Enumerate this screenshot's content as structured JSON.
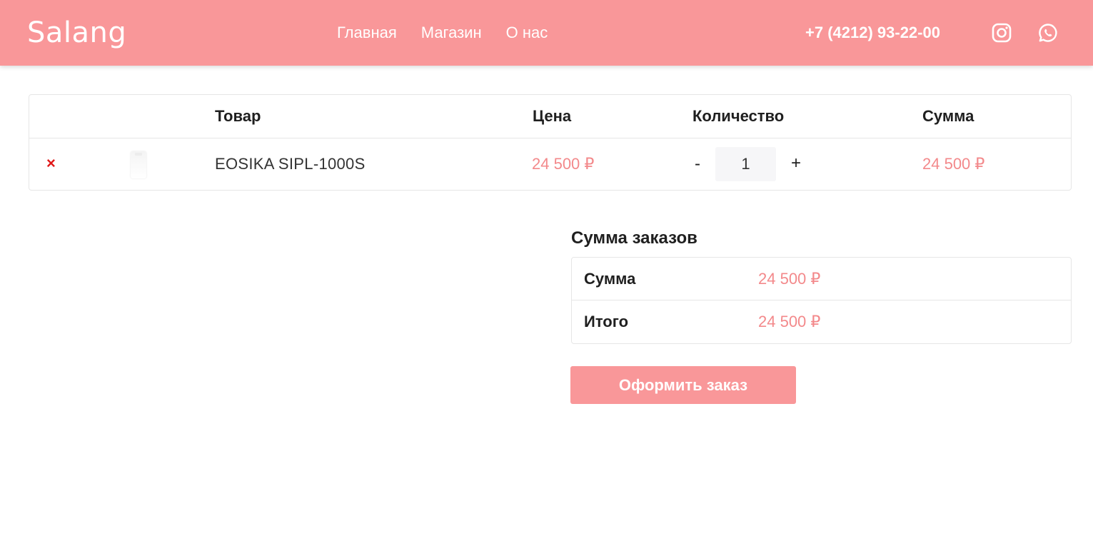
{
  "header": {
    "logo": "Salang",
    "nav": [
      "Главная",
      "Магазин",
      "О нас"
    ],
    "phone": "+7 (4212) 93-22-00",
    "social_icons": [
      "instagram-icon",
      "whatsapp-icon"
    ],
    "background_color": "#f99799"
  },
  "cart": {
    "columns": [
      "",
      "",
      "Товар",
      "Цена",
      "Количество",
      "Сумма"
    ],
    "items": [
      {
        "remove_icon": "×",
        "name": "EOSIKA SIPL-1000S",
        "price": "24 500 ₽",
        "quantity_minus": "-",
        "quantity": "1",
        "quantity_plus": "+",
        "sum": "24 500 ₽"
      }
    ]
  },
  "totals": {
    "title": "Сумма заказов",
    "subtotal_label": "Сумма",
    "subtotal_value": "24 500 ₽",
    "total_label": "Итого",
    "total_value": "24 500 ₽"
  },
  "checkout_label": "Оформить заказ",
  "colors": {
    "accent": "#f99799",
    "price": "#f3898b",
    "remove": "#e01818"
  }
}
